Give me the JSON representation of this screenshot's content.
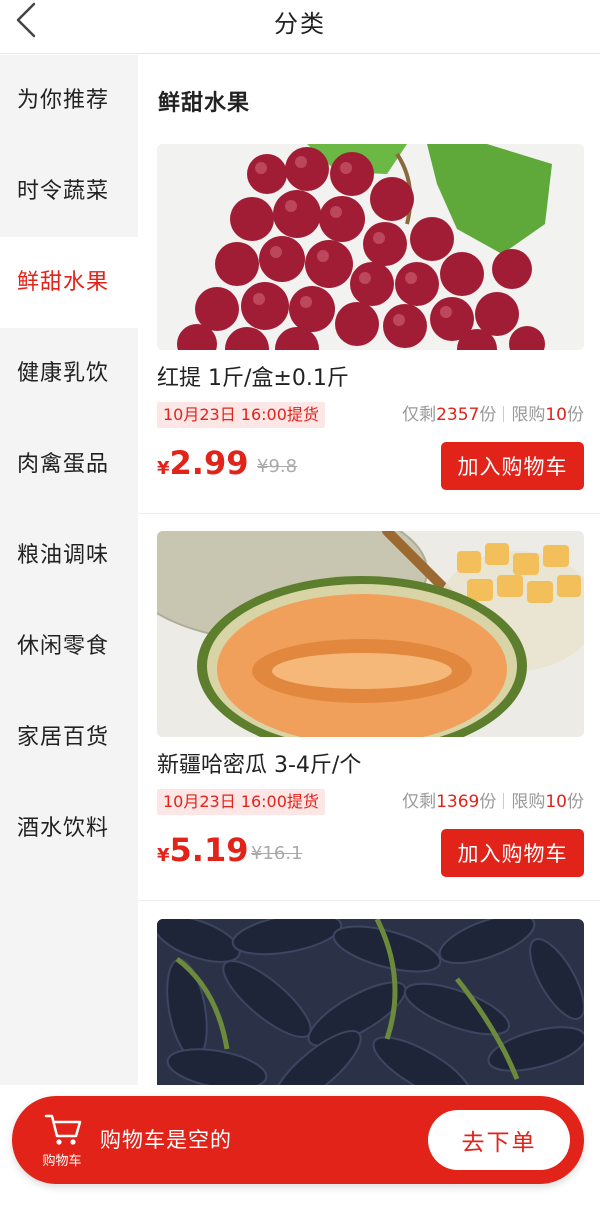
{
  "header": {
    "title": "分类",
    "back_icon": "chevron-left-icon"
  },
  "sidebar": {
    "items": [
      {
        "label": "为你推荐",
        "active": false
      },
      {
        "label": "时令蔬菜",
        "active": false
      },
      {
        "label": "鲜甜水果",
        "active": true
      },
      {
        "label": "健康乳饮",
        "active": false
      },
      {
        "label": "肉禽蛋品",
        "active": false
      },
      {
        "label": "粮油调味",
        "active": false
      },
      {
        "label": "休闲零食",
        "active": false
      },
      {
        "label": "家居百货",
        "active": false
      },
      {
        "label": "酒水饮料",
        "active": false
      }
    ]
  },
  "section": {
    "title": "鲜甜水果"
  },
  "products": [
    {
      "name": "红提 1斤/盒±0.1斤",
      "pickup": "10月23日 16:00提货",
      "stock_prefix": "仅剩",
      "stock": "2357",
      "stock_unit": "份",
      "limit_prefix": "限购",
      "limit": "10",
      "limit_unit": "份",
      "currency": "¥",
      "price": "2.99",
      "orig_price": "¥9.8",
      "add_label": "加入购物车",
      "image": "red-grapes"
    },
    {
      "name": "新疆哈密瓜 3-4斤/个",
      "pickup": "10月23日 16:00提货",
      "stock_prefix": "仅剩",
      "stock": "1369",
      "stock_unit": "份",
      "limit_prefix": "限购",
      "limit": "10",
      "limit_unit": "份",
      "currency": "¥",
      "price": "5.19",
      "orig_price": "¥16.1",
      "add_label": "加入购物车",
      "image": "hami-melon"
    },
    {
      "image": "black-grapes"
    }
  ],
  "cart": {
    "icon": "cart-icon",
    "icon_label": "购物车",
    "empty_text": "购物车是空的",
    "checkout_label": "去下单"
  },
  "colors": {
    "accent": "#e2231a",
    "sidebar_bg": "#f4f4f4",
    "tag_bg": "#fde6e6"
  }
}
